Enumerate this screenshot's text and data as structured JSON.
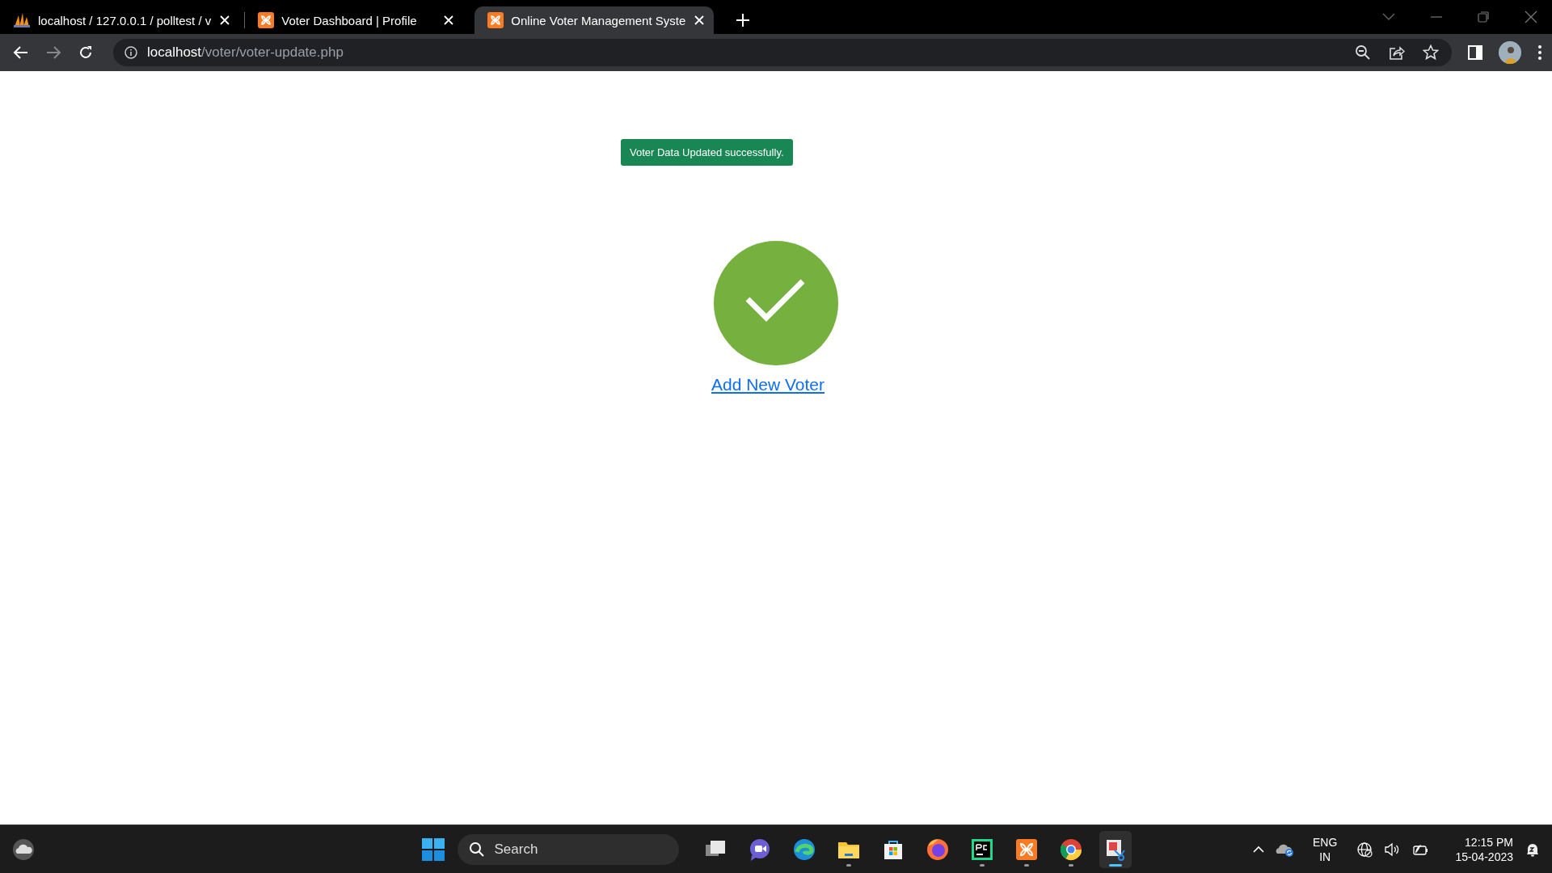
{
  "browser": {
    "tabs": [
      {
        "title": "localhost / 127.0.0.1 / polltest / v",
        "kind": "sails",
        "selected": false
      },
      {
        "title": "Voter Dashboard | Profile",
        "kind": "xampp",
        "selected": false
      },
      {
        "title": "Online Voter Management Syste",
        "kind": "xampp",
        "selected": true
      }
    ],
    "address": {
      "host": "localhost",
      "path": "/voter/voter-update.php"
    }
  },
  "page": {
    "alert": "Voter Data Updated successfully.",
    "link": "Add New Voter"
  },
  "taskbar": {
    "search": {
      "placeholder": "Search"
    },
    "apps": [
      {
        "kind": "task-view",
        "running": false,
        "selected": false
      },
      {
        "kind": "chat",
        "running": false,
        "selected": false
      },
      {
        "kind": "edge",
        "running": false,
        "selected": false
      },
      {
        "kind": "folder",
        "running": true,
        "selected": false
      },
      {
        "kind": "store",
        "running": false,
        "selected": false
      },
      {
        "kind": "firefox",
        "running": false,
        "selected": false
      },
      {
        "kind": "pycharm",
        "running": true,
        "selected": false
      },
      {
        "kind": "xampp",
        "running": true,
        "selected": false
      },
      {
        "kind": "chrome",
        "running": true,
        "selected": false
      },
      {
        "kind": "snipping",
        "running": true,
        "selected": true
      }
    ],
    "tray": {
      "language": "ENG",
      "region": "IN",
      "time": "12:15 PM",
      "date": "15-04-2023"
    }
  }
}
